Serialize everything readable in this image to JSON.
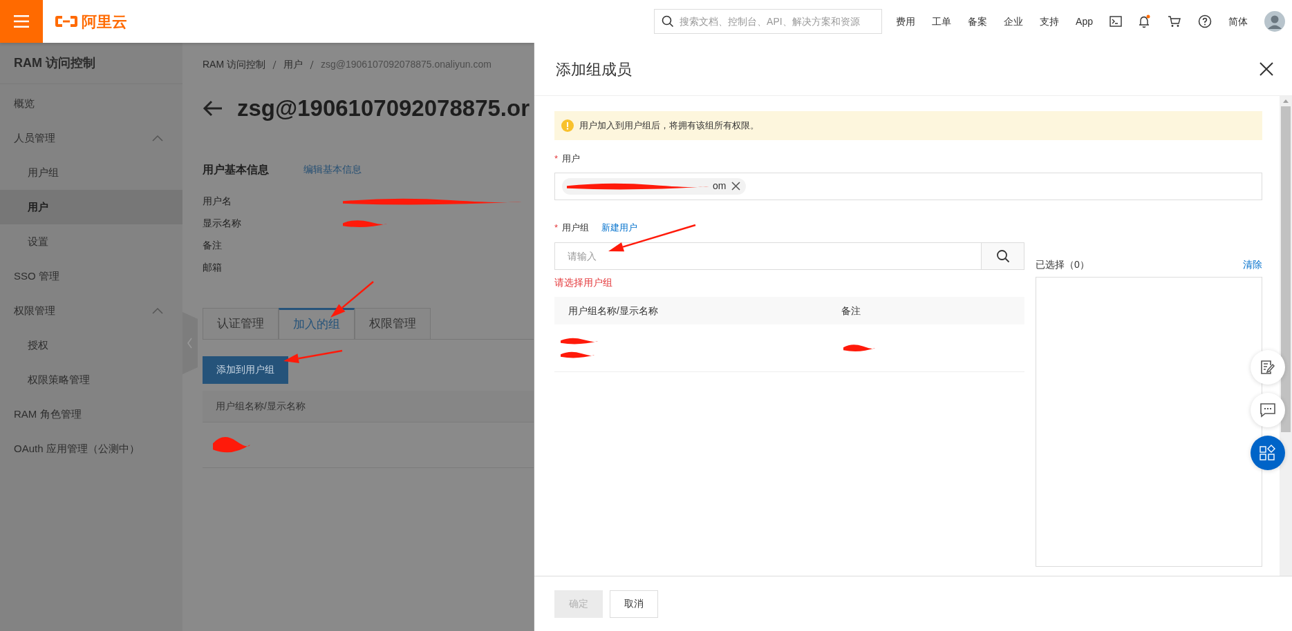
{
  "topbar": {
    "logo_text": "阿里云",
    "search_placeholder": "搜索文档、控制台、API、解决方案和资源",
    "links": [
      "费用",
      "工单",
      "备案",
      "企业",
      "支持",
      "App"
    ],
    "language": "简体"
  },
  "sidebar": {
    "title": "RAM 访问控制",
    "items": [
      {
        "label": "概览",
        "selected": false
      },
      {
        "label": "人员管理",
        "selected": false,
        "expanded": true,
        "children": [
          {
            "label": "用户组",
            "selected": false
          },
          {
            "label": "用户",
            "selected": true
          },
          {
            "label": "设置",
            "selected": false
          }
        ]
      },
      {
        "label": "SSO 管理",
        "selected": false
      },
      {
        "label": "权限管理",
        "selected": false,
        "expanded": true,
        "children": [
          {
            "label": "授权",
            "selected": false
          },
          {
            "label": "权限策略管理",
            "selected": false
          }
        ]
      },
      {
        "label": "RAM 角色管理",
        "selected": false
      },
      {
        "label": "OAuth 应用管理（公测中）",
        "selected": false
      }
    ]
  },
  "page": {
    "breadcrumb": [
      "RAM 访问控制",
      "用户",
      "zsg@1906107092078875.onaliyun.com"
    ],
    "title": "zsg@1906107092078875.or",
    "section_title": "用户基本信息",
    "edit_link": "编辑基本信息",
    "info_labels": [
      "用户名",
      "显示名称",
      "备注",
      "邮箱"
    ],
    "tabs": [
      {
        "label": "认证管理",
        "selected": false
      },
      {
        "label": "加入的组",
        "selected": true
      },
      {
        "label": "权限管理",
        "selected": false
      }
    ],
    "add_button": "添加到用户组",
    "table": {
      "columns": [
        "用户组名称/显示名称"
      ]
    }
  },
  "drawer": {
    "title": "添加组成员",
    "alert": "用户加入到用户组后，将拥有该组所有权限。",
    "user_field": {
      "mark": "*",
      "label": "用户",
      "tag": "om"
    },
    "group_field": {
      "mark": "*",
      "label": "用户组",
      "link": "新建用户",
      "placeholder": "请输入",
      "error": "请选择用户组"
    },
    "table": {
      "columns": [
        "用户组名称/显示名称",
        "备注"
      ]
    },
    "selected_label": "已选择（0）",
    "clear_link": "清除",
    "buttons": [
      {
        "label": "确定",
        "disabled": true
      },
      {
        "label": "取消",
        "disabled": false
      }
    ]
  }
}
